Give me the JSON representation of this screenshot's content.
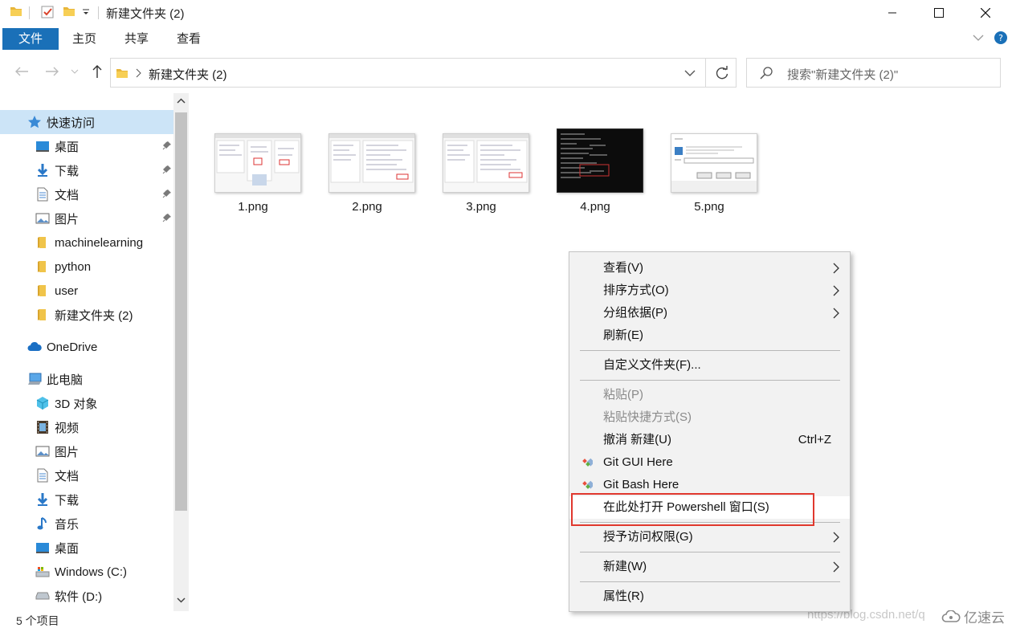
{
  "window": {
    "title": "新建文件夹 (2)"
  },
  "ribbon": {
    "tabs": [
      "文件",
      "主页",
      "共享",
      "查看"
    ]
  },
  "address": {
    "path": "新建文件夹 (2)",
    "search_placeholder": "搜索\"新建文件夹 (2)\""
  },
  "sidebar": {
    "quick_access": "快速访问",
    "quick_items": [
      {
        "label": "桌面",
        "icon": "desktop-icon",
        "pinned": true
      },
      {
        "label": "下载",
        "icon": "download-icon",
        "pinned": true
      },
      {
        "label": "文档",
        "icon": "documents-icon",
        "pinned": true
      },
      {
        "label": "图片",
        "icon": "pictures-icon",
        "pinned": true
      },
      {
        "label": "machinelearning",
        "icon": "folder-icon",
        "pinned": false
      },
      {
        "label": "python",
        "icon": "folder-icon",
        "pinned": false
      },
      {
        "label": "user",
        "icon": "folder-icon",
        "pinned": false
      },
      {
        "label": "新建文件夹 (2)",
        "icon": "folder-icon",
        "pinned": false
      }
    ],
    "onedrive": "OneDrive",
    "this_pc": "此电脑",
    "pc_items": [
      {
        "label": "3D 对象",
        "icon": "3d-objects-icon"
      },
      {
        "label": "视频",
        "icon": "videos-icon"
      },
      {
        "label": "图片",
        "icon": "pictures-icon"
      },
      {
        "label": "文档",
        "icon": "documents-icon"
      },
      {
        "label": "下载",
        "icon": "download-icon"
      },
      {
        "label": "音乐",
        "icon": "music-icon"
      },
      {
        "label": "桌面",
        "icon": "desktop-icon"
      },
      {
        "label": "Windows (C:)",
        "icon": "drive-c-icon"
      },
      {
        "label": "软件 (D:)",
        "icon": "drive-d-icon"
      }
    ]
  },
  "files": [
    {
      "name": "1.png",
      "thumb": "light"
    },
    {
      "name": "2.png",
      "thumb": "light"
    },
    {
      "name": "3.png",
      "thumb": "light"
    },
    {
      "name": "4.png",
      "thumb": "dark"
    },
    {
      "name": "5.png",
      "thumb": "dialog"
    }
  ],
  "context_menu": {
    "items": [
      {
        "label": "查看(V)",
        "submenu": true
      },
      {
        "label": "排序方式(O)",
        "submenu": true
      },
      {
        "label": "分组依据(P)",
        "submenu": true
      },
      {
        "label": "刷新(E)"
      },
      {
        "label": "自定义文件夹(F)..."
      },
      {
        "label": "粘贴(P)",
        "disabled": true
      },
      {
        "label": "粘贴快捷方式(S)",
        "disabled": true
      },
      {
        "label": "撤消 新建(U)",
        "shortcut": "Ctrl+Z"
      },
      {
        "label": "Git GUI Here",
        "icon": "git-icon"
      },
      {
        "label": "Git Bash Here",
        "icon": "git-icon"
      },
      {
        "label": "在此处打开 Powershell 窗口(S)",
        "highlighted": true
      },
      {
        "label": "授予访问权限(G)",
        "submenu": true
      },
      {
        "label": "新建(W)",
        "submenu": true
      },
      {
        "label": "属性(R)"
      }
    ]
  },
  "status": {
    "count": "5 个项目"
  },
  "watermark": {
    "url": "https://blog.csdn.net/q",
    "logo_text": "亿速云"
  },
  "colors": {
    "accent": "#1a70b8",
    "highlight_box": "#e0382e",
    "menu_bg": "#f2f2f2"
  }
}
